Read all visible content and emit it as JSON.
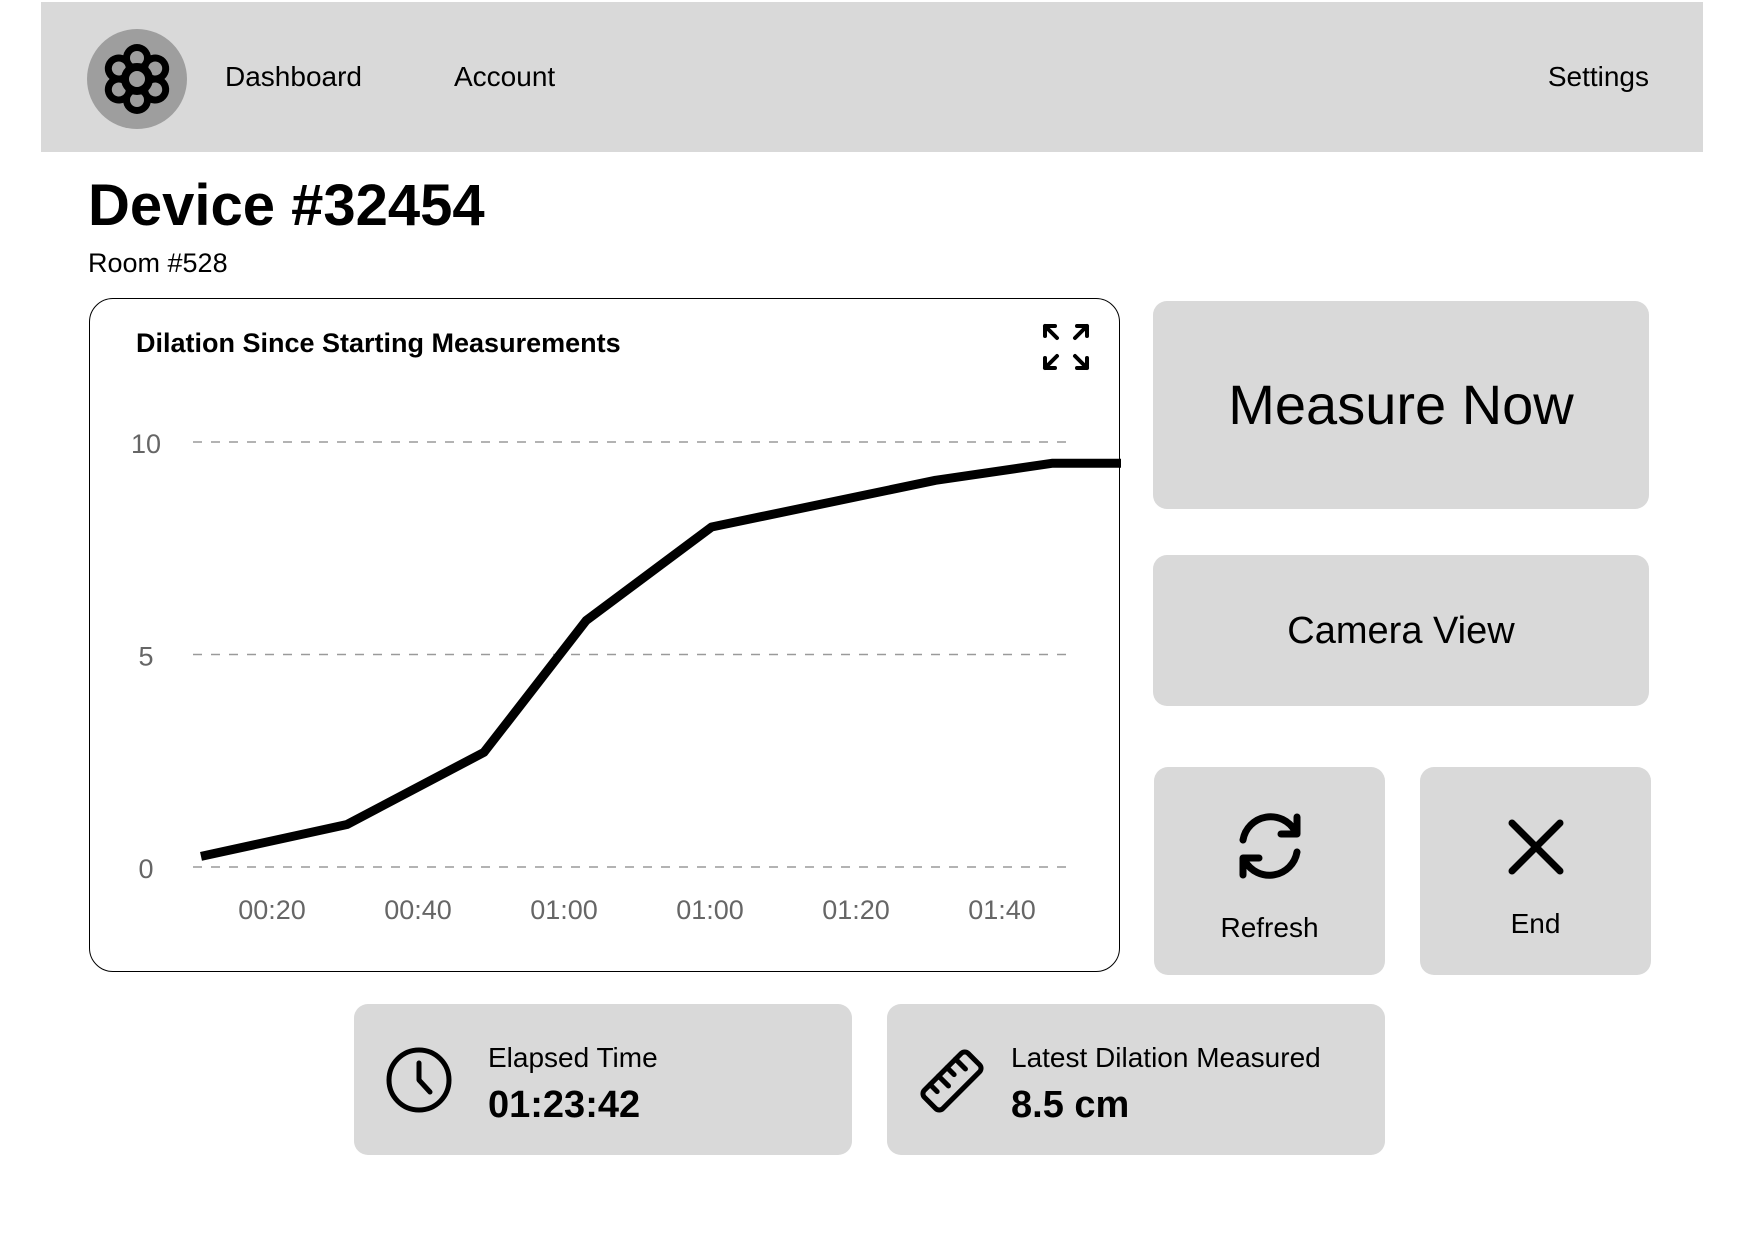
{
  "nav": {
    "logo_icon": "flower-gear-icon",
    "links": [
      "Dashboard",
      "Account"
    ],
    "settings_label": "Settings"
  },
  "page": {
    "title": "Device #32454",
    "subtitle": "Room #528"
  },
  "chart_card": {
    "expand_icon": "expand-arrows-icon"
  },
  "chart_data": {
    "type": "line",
    "title": "Dilation Since Starting Measurements",
    "xlabel": "",
    "ylabel": "",
    "x_tick_labels": [
      "00:20",
      "00:40",
      "01:00",
      "01:00",
      "01:20",
      "01:40"
    ],
    "y_ticks": [
      0,
      5,
      10
    ],
    "ylim": [
      0,
      10
    ],
    "grid": "dashed horizontal",
    "series": [
      {
        "x": [
          0,
          1.63,
          3.16,
          4.3,
          5.7,
          8.2,
          9.5,
          10.9
        ],
        "y": [
          0.25,
          1.0,
          2.7,
          5.8,
          8.0,
          9.1,
          9.5,
          9.5
        ]
      }
    ]
  },
  "actions": {
    "measure_now": "Measure Now",
    "camera_view": "Camera View",
    "refresh": "Refresh",
    "refresh_icon": "refresh-icon",
    "end": "End",
    "end_icon": "close-icon"
  },
  "stats": {
    "elapsed_label": "Elapsed Time",
    "elapsed_value": "01:23:42",
    "elapsed_icon": "clock-icon",
    "dilation_label": "Latest Dilation Measured",
    "dilation_value": "8.5 cm",
    "dilation_icon": "ruler-icon"
  },
  "colors": {
    "panel": "#d9d9d9",
    "logo_bg": "#9e9e9e",
    "line": "#000000",
    "grid": "#9a9a9a",
    "tick_text": "#666666"
  }
}
